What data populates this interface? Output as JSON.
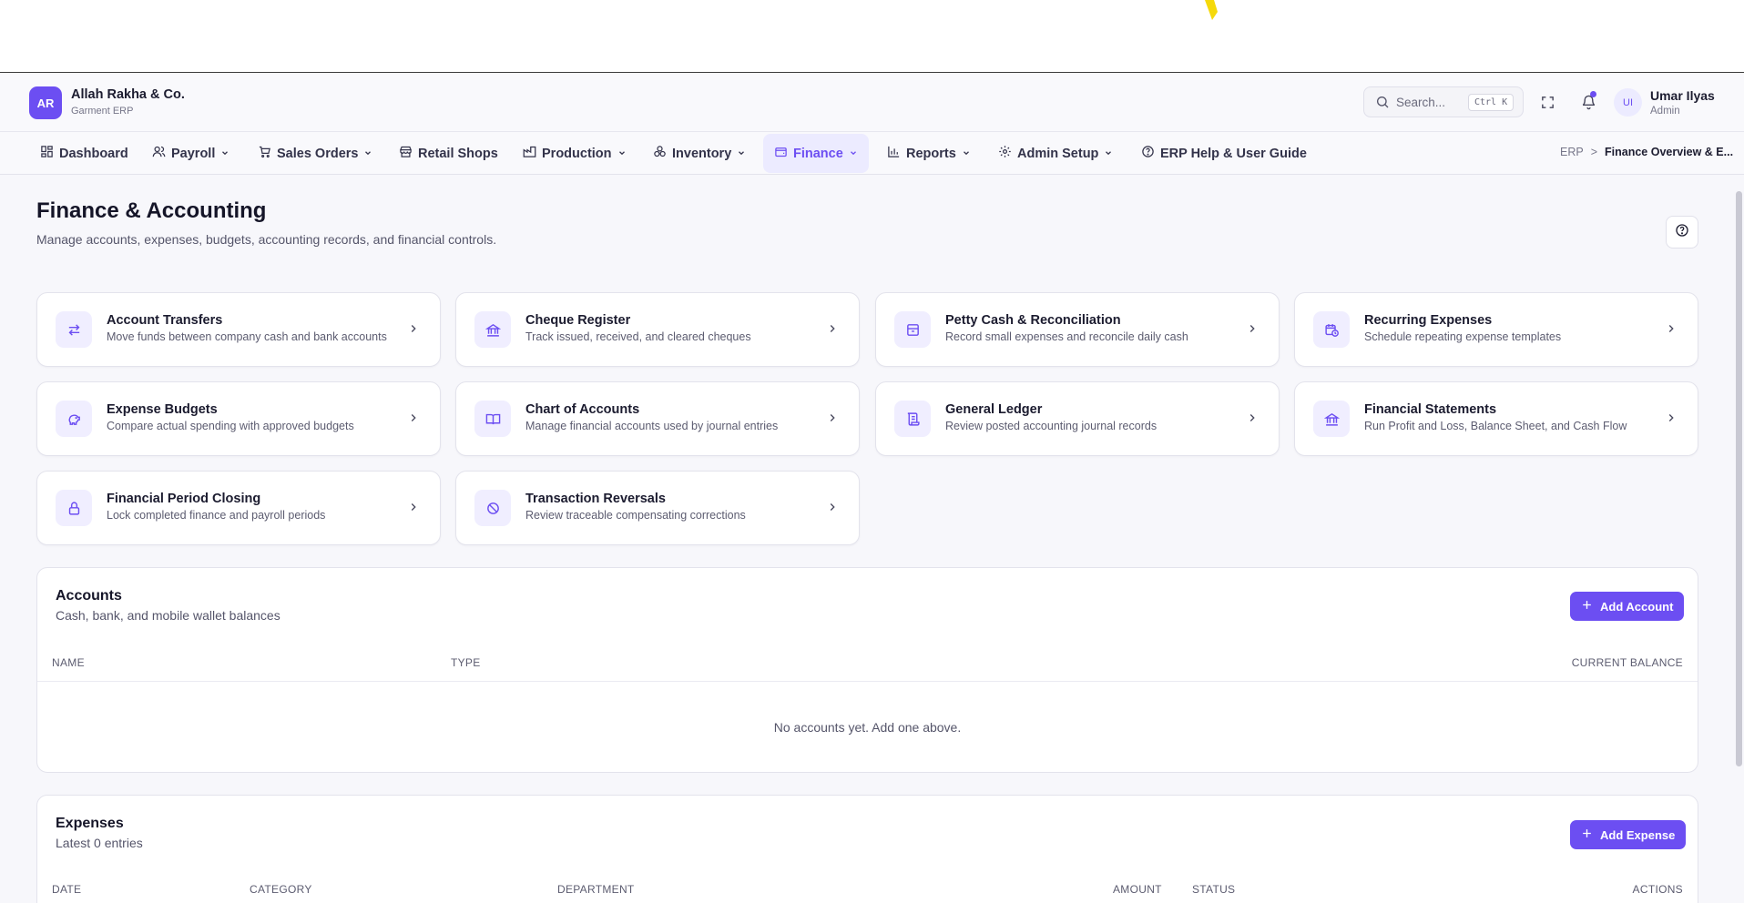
{
  "brand": {
    "initials": "AR",
    "name": "Allah Rakha & Co.",
    "subtitle": "Garment ERP"
  },
  "header": {
    "search_placeholder": "Search...",
    "search_shortcut": "Ctrl K",
    "user_initials": "UI",
    "user_name": "Umar Ilyas",
    "user_role": "Admin"
  },
  "nav": {
    "items": [
      {
        "label": "Dashboard",
        "icon": "grid-icon"
      },
      {
        "label": "Payroll",
        "icon": "users-icon"
      },
      {
        "label": "Sales Orders",
        "icon": "cart-icon"
      },
      {
        "label": "Retail Shops",
        "icon": "store-icon"
      },
      {
        "label": "Production",
        "icon": "factory-icon"
      },
      {
        "label": "Inventory",
        "icon": "boxes-icon"
      },
      {
        "label": "Finance",
        "icon": "wallet-icon",
        "active": true
      },
      {
        "label": "Reports",
        "icon": "bar-chart-icon"
      },
      {
        "label": "Admin Setup",
        "icon": "gear-icon"
      },
      {
        "label": "ERP Help & User Guide",
        "icon": "help-circle-icon"
      }
    ],
    "breadcrumb_root": "ERP",
    "breadcrumb_sep": ">",
    "breadcrumb_current": "Finance Overview & E..."
  },
  "page": {
    "title": "Finance & Accounting",
    "description": "Manage accounts, expenses, budgets, accounting records, and financial controls."
  },
  "tiles": [
    {
      "title": "Account Transfers",
      "desc": "Move funds between company cash and bank accounts",
      "icon": "transfer-icon"
    },
    {
      "title": "Cheque Register",
      "desc": "Track issued, received, and cleared cheques",
      "icon": "bank-icon"
    },
    {
      "title": "Petty Cash & Reconciliation",
      "desc": "Record small expenses and reconcile daily cash",
      "icon": "cash-box-icon"
    },
    {
      "title": "Recurring Expenses",
      "desc": "Schedule repeating expense templates",
      "icon": "calendar-clock-icon"
    },
    {
      "title": "Expense Budgets",
      "desc": "Compare actual spending with approved budgets",
      "icon": "piggy-bank-icon"
    },
    {
      "title": "Chart of Accounts",
      "desc": "Manage financial accounts used by journal entries",
      "icon": "book-open-icon"
    },
    {
      "title": "General Ledger",
      "desc": "Review posted accounting journal records",
      "icon": "scroll-icon"
    },
    {
      "title": "Financial Statements",
      "desc": "Run Profit and Loss, Balance Sheet, and Cash Flow",
      "icon": "landmark-icon"
    },
    {
      "title": "Financial Period Closing",
      "desc": "Lock completed finance and payroll periods",
      "icon": "lock-icon"
    },
    {
      "title": "Transaction Reversals",
      "desc": "Review traceable compensating corrections",
      "icon": "ban-icon"
    }
  ],
  "accounts": {
    "title": "Accounts",
    "subtitle": "Cash, bank, and mobile wallet balances",
    "add_label": "Add Account",
    "columns": [
      "NAME",
      "TYPE",
      "CURRENT BALANCE"
    ],
    "empty": "No accounts yet. Add one above."
  },
  "expenses": {
    "title": "Expenses",
    "subtitle": "Latest 0 entries",
    "add_label": "Add Expense",
    "columns": [
      "DATE",
      "CATEGORY",
      "DEPARTMENT",
      "AMOUNT",
      "STATUS",
      "ACTIONS"
    ]
  },
  "colors": {
    "accent": "#6c4ef2",
    "accent_soft": "#ecebff",
    "text": "#1b1b2f",
    "muted": "#5c5c70"
  }
}
